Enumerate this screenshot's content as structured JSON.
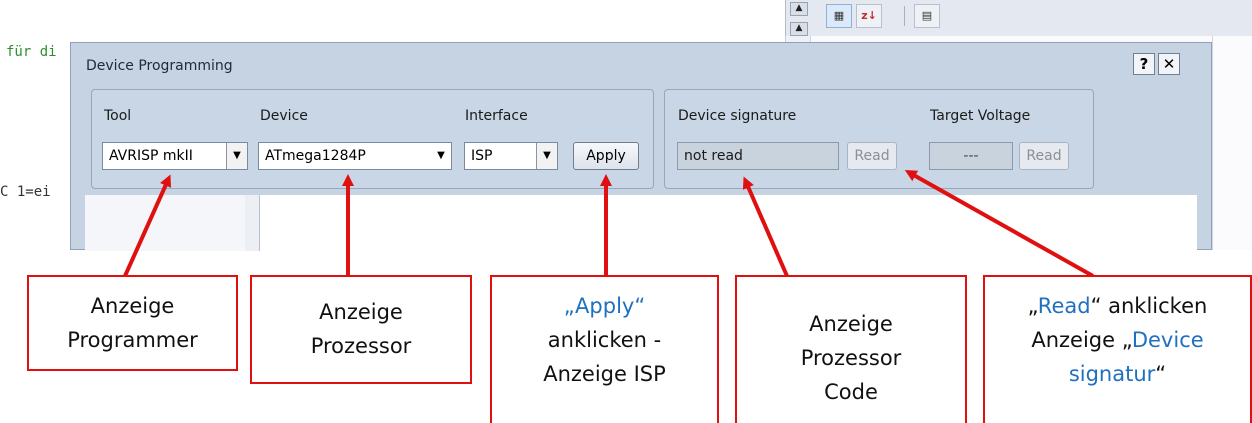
{
  "editor": {
    "line1": "für di",
    "line2": "C 1=ei"
  },
  "toolbar_icons": [
    "categorized-icon",
    "sort-az-icon",
    "property-pages-icon"
  ],
  "dialog": {
    "title": "Device Programming",
    "help_label": "?",
    "close_label": "✕",
    "tool_label": "Tool",
    "tool_value": "AVRISP mkII",
    "device_label": "Device",
    "device_value": "ATmega1284P",
    "interface_label": "Interface",
    "interface_value": "ISP",
    "apply_label": "Apply",
    "signature_label": "Device signature",
    "signature_value": "not read",
    "read_signature_label": "Read",
    "voltage_label": "Target Voltage",
    "voltage_value": "---",
    "read_voltage_label": "Read"
  },
  "callouts": {
    "programmer": [
      "Anzeige",
      "Programmer"
    ],
    "prozessor": [
      "Anzeige",
      "Prozessor"
    ],
    "apply": {
      "line1_prefix": "„",
      "line1_highlight": "Apply",
      "line1_suffix": "“",
      "line2": "anklicken -",
      "line3": "Anzeige ISP"
    },
    "code": [
      "Anzeige",
      "Prozessor",
      "Code"
    ],
    "read": {
      "line1_prefix": "„",
      "line1_highlight": "Read",
      "line1_suffix": "“ anklicken",
      "line2_prefix": "Anzeige „",
      "line2_highlight": "Device",
      "line3_highlight": "signatur",
      "line3_suffix": "“"
    }
  },
  "colors": {
    "callout_border": "#e01010",
    "arrow": "#e01010",
    "highlight_text": "#1f70c0",
    "dialog_bg": "#c5d3e3"
  }
}
